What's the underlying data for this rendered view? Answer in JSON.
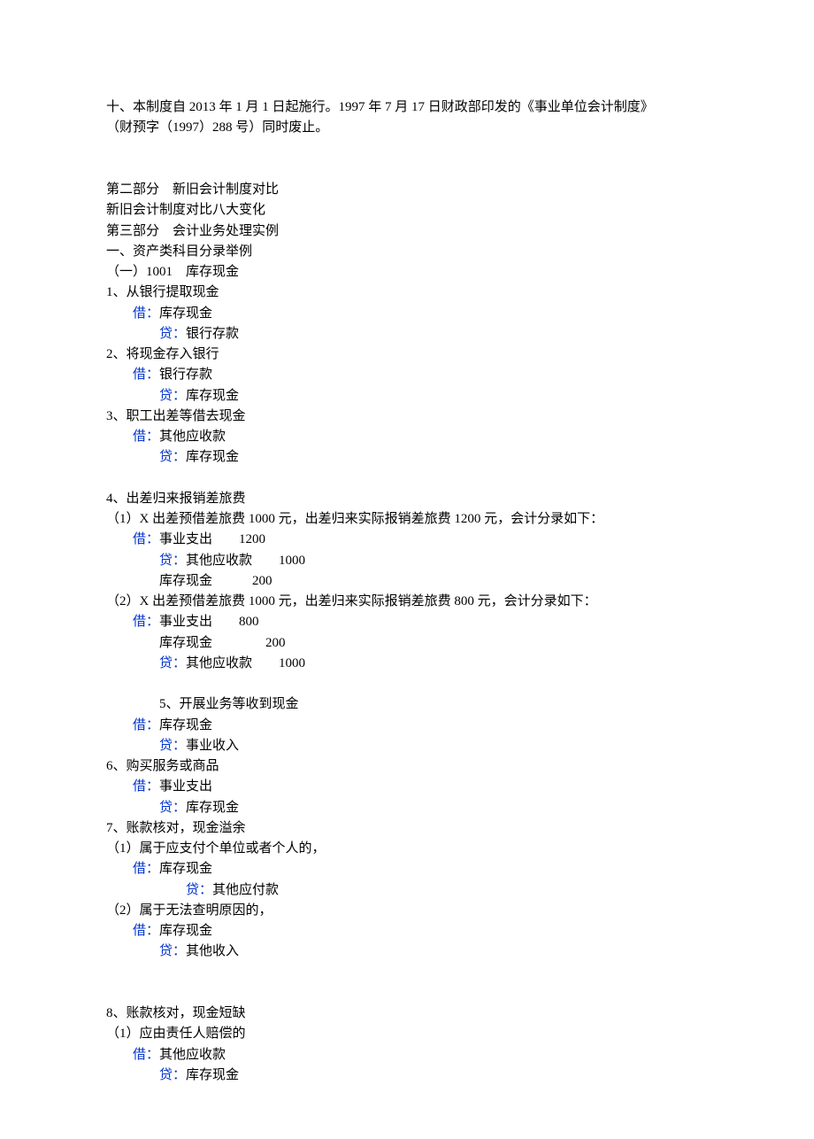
{
  "colors": {
    "accent_blue": "#0033cc"
  },
  "intro": {
    "line1": "十、本制度自 2013 年 1 月 1 日起施行。1997 年 7 月 17 日财政部印发的《事业单位会计制度》",
    "line2": "（财预字（1997）288 号）同时废止。"
  },
  "headers": {
    "p2_title": "第二部分　新旧会计制度对比",
    "p2_sub": "新旧会计制度对比八大变化",
    "p3_title": "第三部分　会计业务处理实例",
    "s1": "一、资产类科目分录举例",
    "s1_1": "（一）1001　库存现金"
  },
  "e1": {
    "t": "1、从银行提取现金",
    "dr_label": "借：",
    "dr": "库存现金",
    "cr_label": "贷：",
    "cr": "银行存款"
  },
  "e2": {
    "t": "2、将现金存入银行",
    "dr_label": "借：",
    "dr": "银行存款",
    "cr_label": "贷：",
    "cr": "库存现金"
  },
  "e3": {
    "t": "3、职工出差等借去现金",
    "dr_label": "借：",
    "dr": "其他应收款",
    "cr_label": "贷：",
    "cr": "库存现金"
  },
  "e4": {
    "t": "4、出差归来报销差旅费",
    "c1": {
      "desc": "（1）X 出差预借差旅费 1000 元，出差归来实际报销差旅费 1200 元，会计分录如下：",
      "dr_label": "借：",
      "dr": "事业支出　　1200",
      "cr_label": "贷：",
      "cr": "其他应收款　　1000",
      "cr2": "库存现金　　　200"
    },
    "c2": {
      "desc": "（2）X 出差预借差旅费 1000 元，出差归来实际报销差旅费 800 元，会计分录如下：",
      "dr_label": "借：",
      "dr": "事业支出　　800",
      "dr2": "库存现金　　　　200",
      "cr_label": "贷：",
      "cr": "其他应收款　　1000"
    }
  },
  "e5": {
    "t": "5、开展业务等收到现金",
    "dr_label": "借：",
    "dr": "库存现金",
    "cr_label": "贷：",
    "cr": "事业收入"
  },
  "e6": {
    "t": "6、购买服务或商品",
    "dr_label": "借：",
    "dr": "事业支出",
    "cr_label": "贷：",
    "cr": "库存现金"
  },
  "e7": {
    "t": "7、账款核对，现金溢余",
    "c1": {
      "desc": "（1）属于应支付个单位或者个人的，",
      "dr_label": "借：",
      "dr": "库存现金",
      "cr_label": "贷：",
      "cr": "其他应付款"
    },
    "c2": {
      "desc": "（2）属于无法查明原因的，",
      "dr_label": "借：",
      "dr": "库存现金",
      "cr_label": "贷：",
      "cr": "其他收入"
    }
  },
  "e8": {
    "t": "8、账款核对，现金短缺",
    "c1": {
      "desc": "（1）应由责任人赔偿的",
      "dr_label": "借：",
      "dr": "其他应收款",
      "cr_label": "贷：",
      "cr": "库存现金"
    }
  }
}
